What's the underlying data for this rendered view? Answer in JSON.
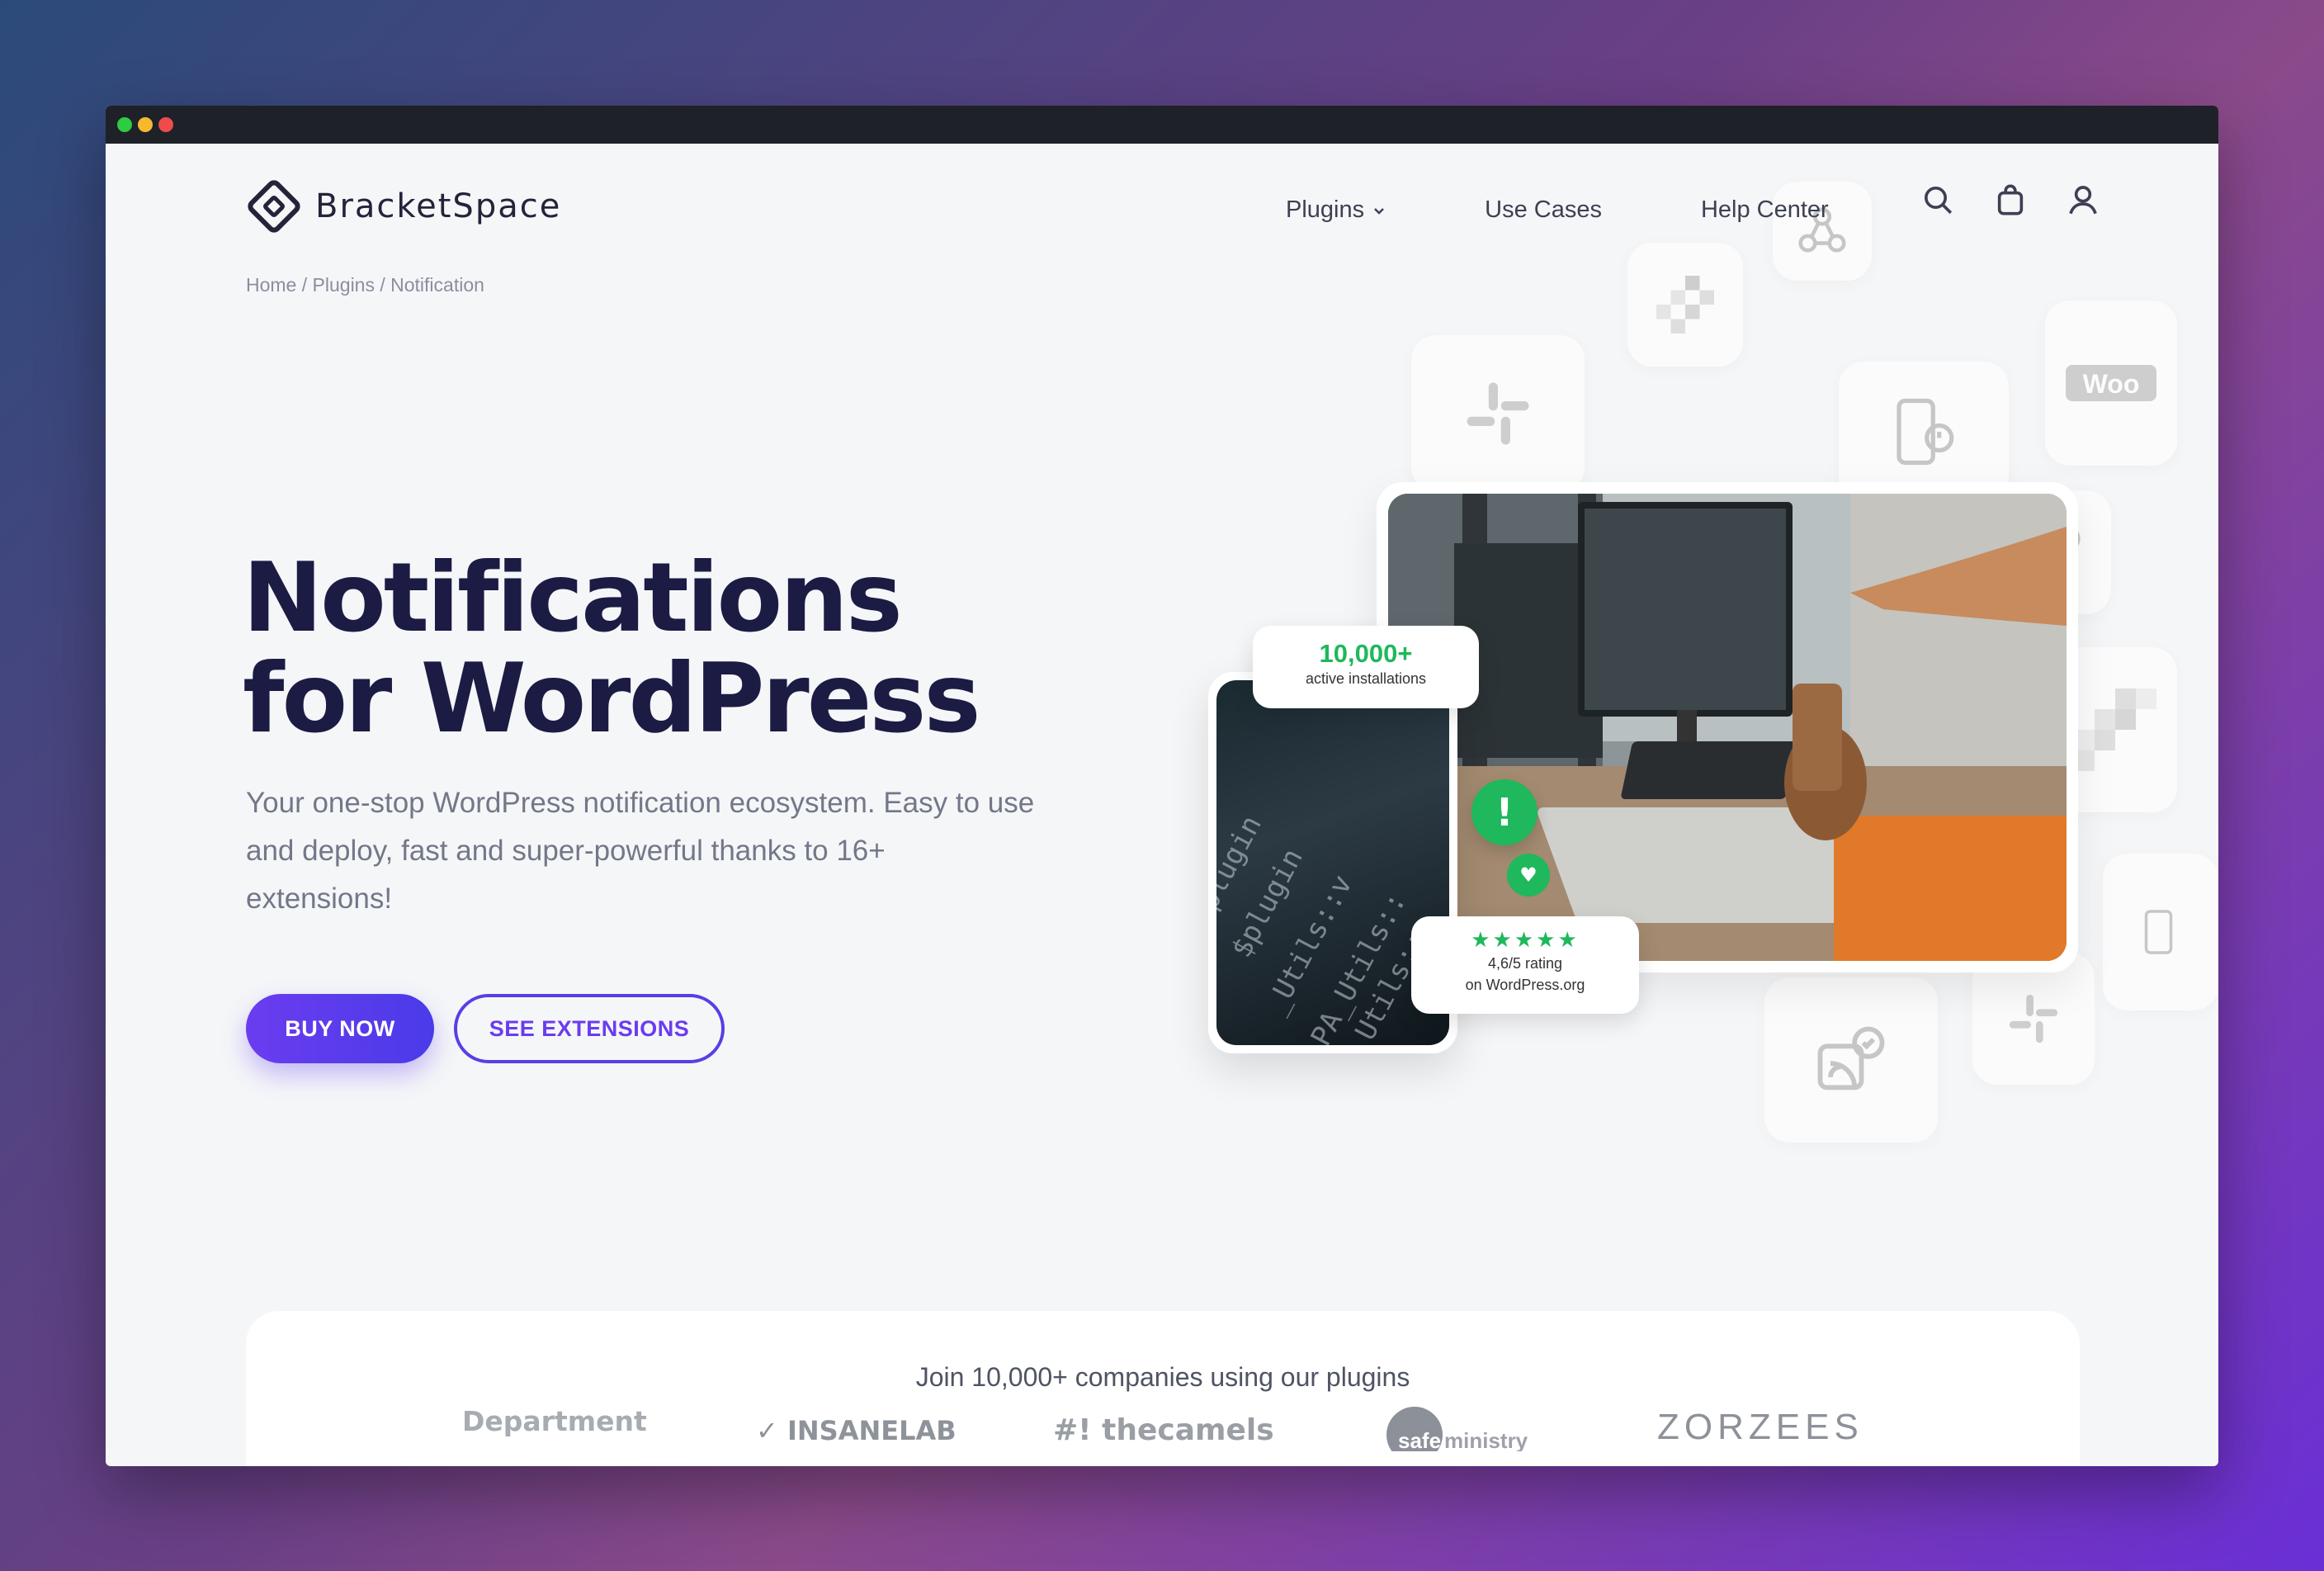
{
  "browser": {
    "window_dots": [
      "green",
      "yellow",
      "red"
    ]
  },
  "header": {
    "logo_text": "BracketSpace",
    "nav": [
      {
        "label": "Plugins",
        "has_dropdown": true
      },
      {
        "label": "Use Cases"
      },
      {
        "label": "Help Center"
      }
    ],
    "icons": [
      "search-icon",
      "cart-icon",
      "user-icon"
    ]
  },
  "breadcrumb": {
    "items": [
      "Home",
      "Plugins",
      "Notification"
    ],
    "separator": " / "
  },
  "hero": {
    "title_line1": "Notifications",
    "title_line2": "for WordPress",
    "subtitle_line1": "Your one-stop WordPress notification ecosystem. Easy to use",
    "subtitle_line2": "and deploy, fast and super-powerful thanks to 16+",
    "subtitle_line3": "extensions!",
    "buy_label": "BUY NOW",
    "extensions_label": "SEE EXTENSIONS"
  },
  "stats": {
    "installs_value": "10,000+",
    "installs_label": "active installations",
    "rating_stars": "★★★★★",
    "rating_line1": "4,6/5 rating",
    "rating_line2": "on WordPress.org"
  },
  "clients": {
    "title": "Join 10,000+ companies using our plugins",
    "logos": [
      "Department",
      "INSANELAB",
      "#! thecamels",
      "safe ministry",
      "ZORZEES"
    ]
  },
  "colors": {
    "accent": "#5a3cec",
    "heading": "#1c1b44",
    "success": "#1fb85c",
    "background": "#f5f6f8"
  }
}
